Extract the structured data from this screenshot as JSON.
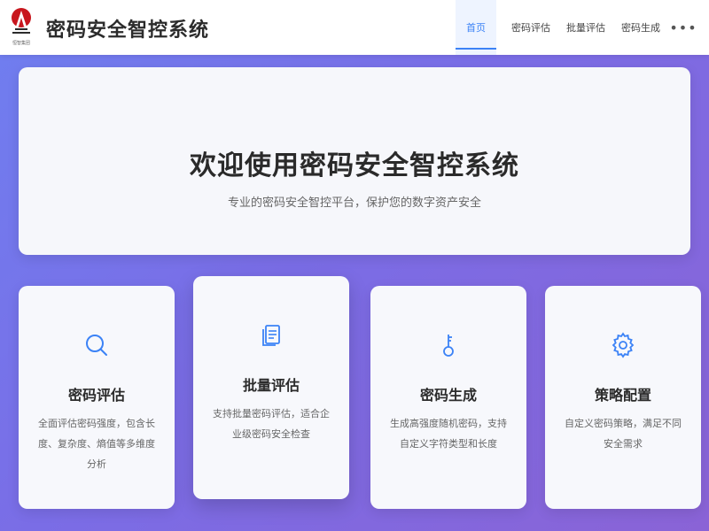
{
  "header": {
    "logo_caption": "恒智集团",
    "title": "密码安全智控系统",
    "nav": [
      {
        "label": "首页",
        "active": true
      },
      {
        "label": "密码评估",
        "active": false
      },
      {
        "label": "批量评估",
        "active": false
      },
      {
        "label": "密码生成",
        "active": false
      }
    ],
    "more_label": "•••"
  },
  "hero": {
    "title": "欢迎使用密码安全智控系统",
    "subtitle": "专业的密码安全智控平台，保护您的数字资产安全"
  },
  "cards": [
    {
      "icon": "search-icon",
      "title": "密码评估",
      "desc": "全面评估密码强度，包含长度、复杂度、熵值等多维度分析"
    },
    {
      "icon": "document-icon",
      "title": "批量评估",
      "desc": "支持批量密码评估，适合企业级密码安全检查"
    },
    {
      "icon": "key-icon",
      "title": "密码生成",
      "desc": "生成高强度随机密码，支持自定义字符类型和长度"
    },
    {
      "icon": "gear-icon",
      "title": "策略配置",
      "desc": "自定义密码策略，满足不同安全需求"
    }
  ],
  "colors": {
    "accent": "#3b82f6",
    "background_start": "#6f7ff0",
    "background_end": "#8a63d6",
    "logo_red": "#c8161d"
  }
}
